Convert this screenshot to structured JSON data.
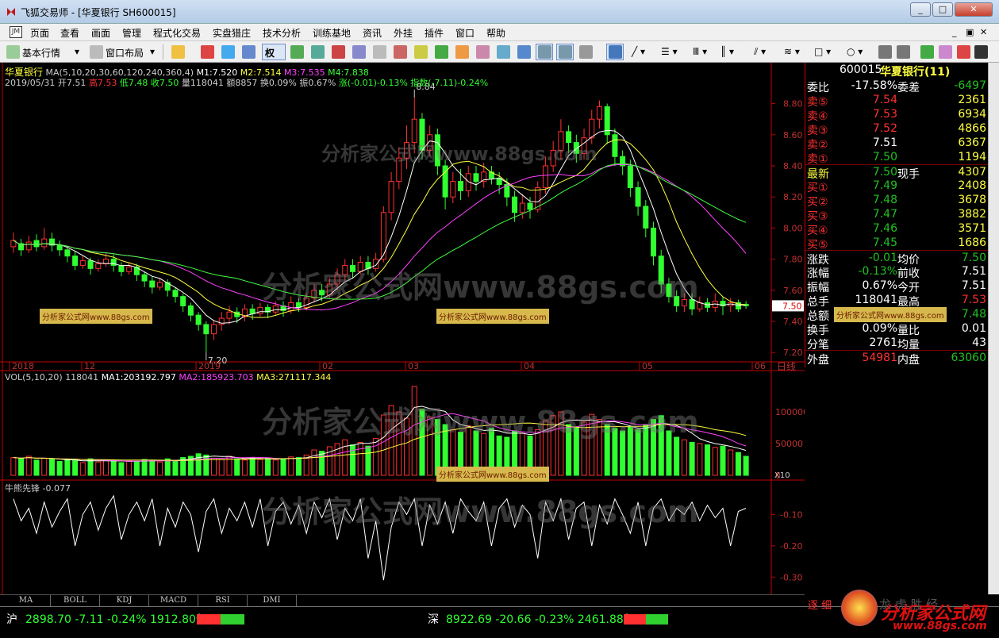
{
  "window": {
    "title": "飞狐交易师 - [华夏银行 SH600015]",
    "buttons": [
      "_",
      "□",
      "✕"
    ]
  },
  "menu": {
    "items": [
      "页面",
      "查看",
      "画面",
      "管理",
      "程式化交易",
      "实盘猎庄",
      "技术分析",
      "训练基地",
      "资讯",
      "外挂",
      "插件",
      "窗口",
      "帮助"
    ],
    "logo": "JM"
  },
  "toolbar": {
    "basic_quote": "基本行情",
    "window_layout": "窗口布局",
    "quan": "权"
  },
  "chart": {
    "stock_name": "华夏银行",
    "ma_line": "MA(5,10,20,30,60,120,240,360,4)",
    "m1": "M1:7.520",
    "m2": "M2:7.514",
    "m3": "M3:7.535",
    "m4": "M4:7.838",
    "date": "2019/05/31",
    "open": "开7.51",
    "high": "高7.53",
    "low": "低7.48",
    "close": "收7.50",
    "volume": "量118041",
    "amount": "额8857",
    "turnover": "换0.09%",
    "amplitude": "振0.67%",
    "change": "涨(-0.01)-0.13%",
    "index": "指数(-7.11)-0.24%",
    "max_label": "8.84",
    "min_label": "7.20",
    "price_marker": "7.50",
    "y_ticks": [
      "8.80",
      "8.60",
      "8.40",
      "8.20",
      "8.00",
      "7.80",
      "7.60",
      "7.40",
      "7.20"
    ],
    "x_ticks": [
      "2018",
      "12",
      "2019",
      "02",
      "03",
      "04",
      "05",
      "06"
    ],
    "period": "日线",
    "vol_line": "VOL(5,10,20)",
    "vol_value": "118041",
    "vma1": "MA1:203192.797",
    "vma2": "MA2:185923.703",
    "vma3": "MA3:271117.344",
    "vol_ticks": [
      "100000",
      "50000",
      "0"
    ],
    "vol_unit": "X10",
    "ind_name": "牛熊先锋",
    "ind_value": "-0.077",
    "ind_ticks": [
      "-0.10",
      "-0.20",
      "-0.30"
    ]
  },
  "watermarks": {
    "big": "分析家公式网www.88gs.com",
    "small": "分析家公式网www.88gs.com"
  },
  "tabs": [
    "MA",
    "BOLL",
    "KDJ",
    "MACD",
    "RSI",
    "DMI"
  ],
  "quote": {
    "code": "600015",
    "name": "华夏银行(11)",
    "rows": [
      {
        "l": "委比",
        "v": "-17.58%",
        "l2": "委差",
        "v2": "-6497",
        "c": "#ffffff",
        "c2": "#20c020"
      },
      {
        "l": "卖⑤",
        "v": "7.54",
        "l2": "",
        "v2": "2361",
        "c": "#ff3030",
        "c2": "#ffff40"
      },
      {
        "l": "卖④",
        "v": "7.53",
        "l2": "",
        "v2": "6934",
        "c": "#ff3030",
        "c2": "#ffff40"
      },
      {
        "l": "卖③",
        "v": "7.52",
        "l2": "",
        "v2": "4866",
        "c": "#ff3030",
        "c2": "#ffff40"
      },
      {
        "l": "卖②",
        "v": "7.51",
        "l2": "",
        "v2": "6367",
        "c": "#ffffff",
        "c2": "#ffff40"
      },
      {
        "l": "卖①",
        "v": "7.50",
        "l2": "",
        "v2": "1194",
        "c": "#20c020",
        "c2": "#ffff40"
      },
      {
        "l": "最新",
        "v": "7.50",
        "l2": "现手",
        "v2": "4307",
        "c": "#20c020",
        "c2": "#ffff40"
      },
      {
        "l": "买①",
        "v": "7.49",
        "l2": "",
        "v2": "2408",
        "c": "#20c020",
        "c2": "#ffff40"
      },
      {
        "l": "买②",
        "v": "7.48",
        "l2": "",
        "v2": "3678",
        "c": "#20c020",
        "c2": "#ffff40"
      },
      {
        "l": "买③",
        "v": "7.47",
        "l2": "",
        "v2": "3882",
        "c": "#20c020",
        "c2": "#ffff40"
      },
      {
        "l": "买④",
        "v": "7.46",
        "l2": "",
        "v2": "3571",
        "c": "#20c020",
        "c2": "#ffff40"
      },
      {
        "l": "买⑤",
        "v": "7.45",
        "l2": "",
        "v2": "1686",
        "c": "#20c020",
        "c2": "#ffff40"
      },
      {
        "l": "涨跌",
        "v": "-0.01",
        "l2": "均价",
        "v2": "7.50",
        "c": "#20c020",
        "c2": "#20c020"
      },
      {
        "l": "涨幅",
        "v": "-0.13%",
        "l2": "前收",
        "v2": "7.51",
        "c": "#20c020",
        "c2": "#ffffff"
      },
      {
        "l": "振幅",
        "v": "0.67%",
        "l2": "今开",
        "v2": "7.51",
        "c": "#ffffff",
        "c2": "#ffffff"
      },
      {
        "l": "总手",
        "v": "118041",
        "l2": "最高",
        "v2": "7.53",
        "c": "#ffffff",
        "c2": "#ff3030"
      },
      {
        "l": "总额",
        "v": "8857",
        "l2": "最低",
        "v2": "7.48",
        "c": "#ffffff",
        "c2": "#20c020"
      },
      {
        "l": "换手",
        "v": "0.09%",
        "l2": "量比",
        "v2": "0.01",
        "c": "#ffffff",
        "c2": "#ffffff"
      },
      {
        "l": "分笔",
        "v": "2761",
        "l2": "均量",
        "v2": "43",
        "c": "#ffffff",
        "c2": "#ffffff"
      },
      {
        "l": "外盘",
        "v": "54981",
        "l2": "内盘",
        "v2": "63060",
        "c": "#ff3030",
        "c2": "#20c020"
      }
    ]
  },
  "status": {
    "sh_label": "沪",
    "sh_value": "2898.70 -7.11 -0.24% 1912.80亿",
    "sz_label": "深",
    "sz_value": "8922.69 -20.66 -0.23% 2461.88亿",
    "brand": "分析家公式网",
    "brand_url": "www.88gs.com",
    "corner_text": "逐 细",
    "corner_text2": "龙 虎 胜 经"
  },
  "colors": {
    "up": "#ff3030",
    "down": "#30ff30",
    "ma1": "#ffffff",
    "ma2": "#ffff40",
    "ma3": "#ff40ff",
    "ma4": "#40ff40",
    "axis": "#c00000"
  },
  "chart_data": {
    "type": "candlestick",
    "title": "华夏银行",
    "ylim": [
      7.15,
      8.9
    ],
    "candles": [
      [
        7.88,
        7.92,
        7.84,
        7.97
      ],
      [
        7.9,
        7.86,
        7.82,
        7.93
      ],
      [
        7.86,
        7.91,
        7.84,
        7.95
      ],
      [
        7.92,
        7.88,
        7.85,
        7.96
      ],
      [
        7.88,
        7.93,
        7.86,
        8.0
      ],
      [
        7.93,
        7.89,
        7.85,
        7.97
      ],
      [
        7.89,
        7.86,
        7.82,
        7.92
      ],
      [
        7.86,
        7.82,
        7.78,
        7.88
      ],
      [
        7.82,
        7.76,
        7.73,
        7.85
      ],
      [
        7.76,
        7.79,
        7.74,
        7.82
      ],
      [
        7.79,
        7.74,
        7.7,
        7.81
      ],
      [
        7.74,
        7.77,
        7.72,
        7.8
      ],
      [
        7.77,
        7.8,
        7.75,
        7.84
      ],
      [
        7.8,
        7.76,
        7.72,
        7.83
      ],
      [
        7.76,
        7.72,
        7.69,
        7.78
      ],
      [
        7.72,
        7.75,
        7.7,
        7.78
      ],
      [
        7.75,
        7.7,
        7.66,
        7.77
      ],
      [
        7.7,
        7.66,
        7.62,
        7.72
      ],
      [
        7.66,
        7.62,
        7.58,
        7.69
      ],
      [
        7.62,
        7.65,
        7.6,
        7.68
      ],
      [
        7.65,
        7.6,
        7.56,
        7.67
      ],
      [
        7.6,
        7.56,
        7.52,
        7.62
      ],
      [
        7.56,
        7.5,
        7.46,
        7.58
      ],
      [
        7.5,
        7.44,
        7.4,
        7.52
      ],
      [
        7.44,
        7.38,
        7.34,
        7.46
      ],
      [
        7.38,
        7.32,
        7.2,
        7.4
      ],
      [
        7.32,
        7.38,
        7.28,
        7.41
      ],
      [
        7.38,
        7.42,
        7.34,
        7.46
      ],
      [
        7.42,
        7.46,
        7.38,
        7.5
      ],
      [
        7.46,
        7.43,
        7.39,
        7.49
      ],
      [
        7.43,
        7.48,
        7.4,
        7.51
      ],
      [
        7.48,
        7.45,
        7.41,
        7.51
      ],
      [
        7.45,
        7.49,
        7.43,
        7.52
      ],
      [
        7.49,
        7.46,
        7.42,
        7.51
      ],
      [
        7.46,
        7.5,
        7.44,
        7.53
      ],
      [
        7.5,
        7.47,
        7.43,
        7.53
      ],
      [
        7.47,
        7.52,
        7.45,
        7.56
      ],
      [
        7.52,
        7.49,
        7.46,
        7.55
      ],
      [
        7.49,
        7.55,
        7.47,
        7.58
      ],
      [
        7.55,
        7.6,
        7.52,
        7.64
      ],
      [
        7.6,
        7.57,
        7.53,
        7.64
      ],
      [
        7.57,
        7.64,
        7.55,
        7.68
      ],
      [
        7.64,
        7.7,
        7.6,
        7.74
      ],
      [
        7.7,
        7.76,
        7.66,
        7.8
      ],
      [
        7.76,
        7.72,
        7.68,
        7.8
      ],
      [
        7.72,
        7.78,
        7.7,
        7.82
      ],
      [
        7.78,
        7.74,
        7.7,
        7.82
      ],
      [
        7.74,
        7.8,
        7.72,
        7.84
      ],
      [
        7.8,
        8.1,
        7.78,
        8.14
      ],
      [
        8.1,
        8.3,
        8.05,
        8.36
      ],
      [
        8.3,
        8.45,
        8.25,
        8.52
      ],
      [
        8.45,
        8.55,
        8.38,
        8.66
      ],
      [
        8.55,
        8.7,
        8.48,
        8.84
      ],
      [
        8.7,
        8.5,
        8.44,
        8.74
      ],
      [
        8.5,
        8.6,
        8.46,
        8.66
      ],
      [
        8.6,
        8.4,
        8.34,
        8.64
      ],
      [
        8.4,
        8.2,
        8.12,
        8.44
      ],
      [
        8.2,
        8.3,
        8.16,
        8.36
      ],
      [
        8.3,
        8.24,
        8.18,
        8.38
      ],
      [
        8.24,
        8.35,
        8.2,
        8.4
      ],
      [
        8.35,
        8.3,
        8.24,
        8.4
      ],
      [
        8.3,
        8.36,
        8.26,
        8.42
      ],
      [
        8.36,
        8.32,
        8.28,
        8.4
      ],
      [
        8.32,
        8.28,
        8.22,
        8.36
      ],
      [
        8.28,
        8.2,
        8.14,
        8.32
      ],
      [
        8.2,
        8.1,
        8.04,
        8.24
      ],
      [
        8.1,
        8.16,
        8.06,
        8.22
      ],
      [
        8.16,
        8.12,
        8.06,
        8.2
      ],
      [
        8.12,
        8.26,
        8.1,
        8.3
      ],
      [
        8.26,
        8.4,
        8.22,
        8.46
      ],
      [
        8.4,
        8.5,
        8.36,
        8.56
      ],
      [
        8.5,
        8.62,
        8.44,
        8.7
      ],
      [
        8.62,
        8.55,
        8.48,
        8.66
      ],
      [
        8.55,
        8.48,
        8.42,
        8.6
      ],
      [
        8.48,
        8.58,
        8.44,
        8.64
      ],
      [
        8.58,
        8.7,
        8.54,
        8.76
      ],
      [
        8.7,
        8.78,
        8.64,
        8.82
      ],
      [
        8.78,
        8.6,
        8.54,
        8.8
      ],
      [
        8.6,
        8.46,
        8.4,
        8.64
      ],
      [
        8.46,
        8.4,
        8.34,
        8.5
      ],
      [
        8.4,
        8.26,
        8.2,
        8.44
      ],
      [
        8.26,
        8.14,
        8.08,
        8.3
      ],
      [
        8.14,
        8.0,
        7.94,
        8.18
      ],
      [
        8.0,
        7.82,
        7.76,
        8.04
      ],
      [
        7.82,
        7.64,
        7.58,
        7.86
      ],
      [
        7.64,
        7.56,
        7.52,
        7.68
      ],
      [
        7.56,
        7.5,
        7.46,
        7.6
      ],
      [
        7.5,
        7.54,
        7.46,
        7.58
      ],
      [
        7.54,
        7.48,
        7.44,
        7.58
      ],
      [
        7.48,
        7.52,
        7.46,
        7.56
      ],
      [
        7.52,
        7.49,
        7.46,
        7.55
      ],
      [
        7.49,
        7.53,
        7.46,
        7.58
      ],
      [
        7.53,
        7.5,
        7.44,
        7.56
      ],
      [
        7.5,
        7.52,
        7.46,
        7.55
      ],
      [
        7.52,
        7.48,
        7.46,
        7.54
      ],
      [
        7.51,
        7.5,
        7.48,
        7.53
      ]
    ],
    "volume": [
      28,
      26,
      30,
      24,
      27,
      25,
      22,
      24,
      23,
      20,
      26,
      21,
      24,
      22,
      20,
      23,
      22,
      25,
      24,
      21,
      26,
      22,
      28,
      30,
      34,
      32,
      27,
      25,
      30,
      26,
      24,
      28,
      25,
      27,
      24,
      26,
      29,
      28,
      32,
      40,
      38,
      45,
      50,
      56,
      48,
      52,
      46,
      58,
      95,
      110,
      100,
      90,
      140,
      104,
      92,
      88,
      80,
      72,
      68,
      78,
      70,
      66,
      74,
      62,
      60,
      70,
      66,
      62,
      72,
      86,
      94,
      100,
      80,
      76,
      84,
      96,
      88,
      80,
      74,
      70,
      76,
      72,
      80,
      88,
      94,
      70,
      60,
      56,
      52,
      50,
      48,
      44,
      46,
      40,
      36,
      30
    ],
    "indicator": [
      -0.05,
      -0.12,
      -0.08,
      -0.16,
      -0.06,
      -0.14,
      -0.09,
      -0.05,
      -0.2,
      -0.1,
      -0.06,
      -0.15,
      -0.08,
      -0.04,
      -0.18,
      -0.1,
      -0.06,
      -0.12,
      -0.05,
      -0.2,
      -0.08,
      -0.14,
      -0.06,
      -0.1,
      -0.22,
      -0.09,
      -0.05,
      -0.16,
      -0.08,
      -0.12,
      -0.06,
      -0.14,
      -0.05,
      -0.2,
      -0.09,
      -0.06,
      -0.13,
      -0.07,
      -0.16,
      -0.06,
      -0.11,
      -0.05,
      -0.18,
      -0.08,
      -0.12,
      -0.05,
      -0.24,
      -0.12,
      -0.31,
      -0.14,
      -0.06,
      -0.1,
      -0.05,
      -0.2,
      -0.07,
      -0.13,
      -0.06,
      -0.16,
      -0.05,
      -0.09,
      -0.12,
      -0.06,
      -0.2,
      -0.08,
      -0.05,
      -0.14,
      -0.07,
      -0.1,
      -0.24,
      -0.06,
      -0.12,
      -0.05,
      -0.18,
      -0.08,
      -0.06,
      -0.2,
      -0.07,
      -0.13,
      -0.05,
      -0.1,
      -0.16,
      -0.06,
      -0.2,
      -0.08,
      -0.05,
      -0.12,
      -0.08,
      -0.1,
      -0.06,
      -0.12,
      -0.07,
      -0.11,
      -0.08,
      -0.2,
      -0.09,
      -0.08
    ]
  }
}
